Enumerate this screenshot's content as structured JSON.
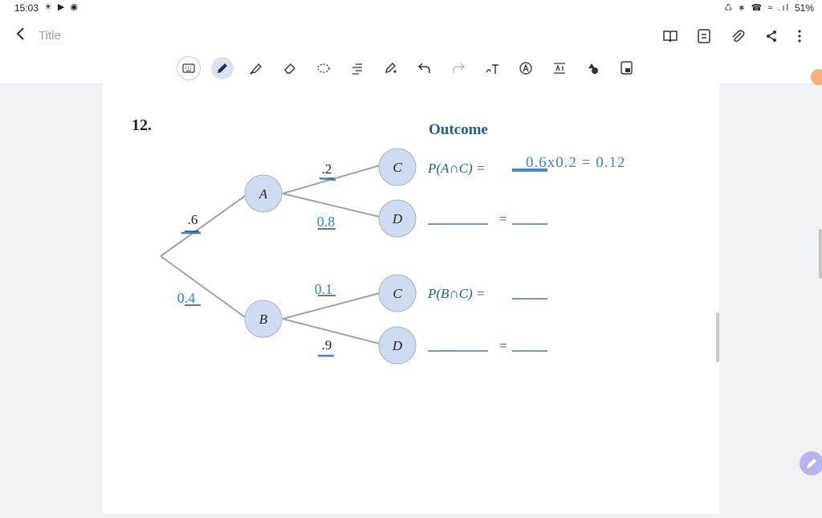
{
  "status": {
    "time": "15:03",
    "battery": "51%"
  },
  "header": {
    "back_icon": "chevron-left-icon",
    "title": "Title",
    "actions": [
      {
        "name": "book-view-button",
        "icon": "book-icon"
      },
      {
        "name": "page-list-button",
        "icon": "list-icon"
      },
      {
        "name": "attach-button",
        "icon": "paperclip-icon"
      },
      {
        "name": "share-button",
        "icon": "share-icon"
      },
      {
        "name": "more-button",
        "icon": "more-vertical-icon"
      }
    ]
  },
  "toolbar": {
    "tools": [
      "keyboard",
      "pen",
      "highlighter",
      "eraser",
      "lasso",
      "text-align",
      "pen-settings",
      "undo",
      "redo",
      "handwriting-to-text",
      "text-style",
      "text-box",
      "shapes",
      "insert-image"
    ],
    "active": "pen"
  },
  "exercise": {
    "number": "12.",
    "heading": "Outcome",
    "nodes": {
      "a": "A",
      "b": "B",
      "c1": "C",
      "d1": "D",
      "c2": "C",
      "d2": "D"
    },
    "branch_labels": {
      "start_a": ".6",
      "a_c": ".2",
      "b_d": ".9"
    },
    "outcomes": {
      "row1": "P(A∩C) =",
      "row3": "P(B∩C) ="
    },
    "equals": "="
  },
  "handwriting": {
    "start_b": "0.4",
    "a_d": "0.8",
    "b_c": "0.1",
    "row1_answer": "0.6x0.2 = 0.12"
  },
  "colors": {
    "node_fill": "#cfdcef",
    "blue_text": "#1f5f95",
    "ink": "#2f86e0"
  }
}
